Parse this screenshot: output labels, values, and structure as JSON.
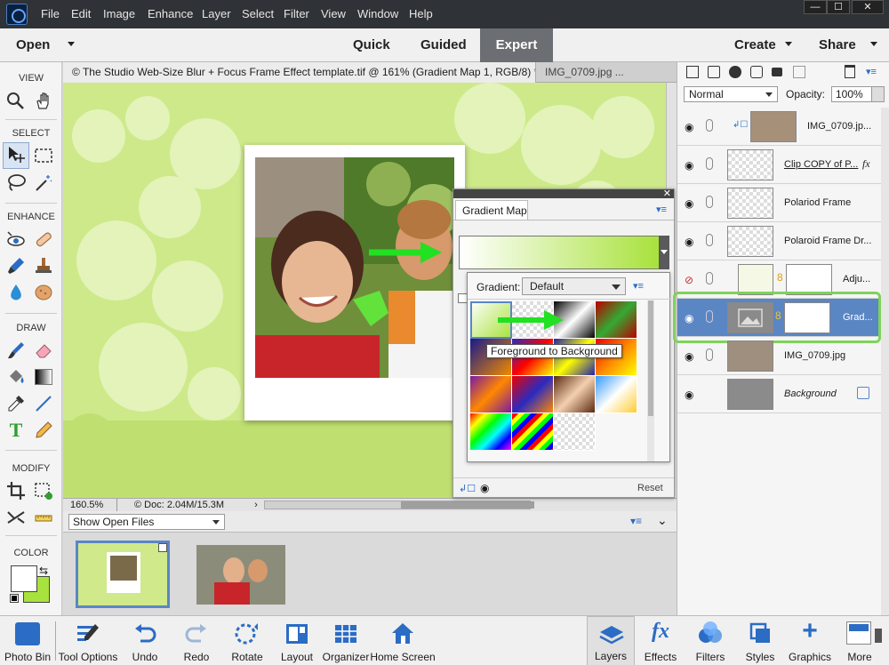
{
  "menubar": {
    "items": [
      "File",
      "Edit",
      "Image",
      "Enhance",
      "Layer",
      "Select",
      "Filter",
      "View",
      "Window",
      "Help"
    ],
    "window_buttons": [
      "—",
      "☐",
      "✕"
    ]
  },
  "modebar": {
    "open": "Open",
    "quick": "Quick",
    "guided": "Guided",
    "expert": "Expert",
    "create": "Create",
    "share": "Share"
  },
  "toolbox": {
    "view": "VIEW",
    "select": "SELECT",
    "enhance": "ENHANCE",
    "draw": "DRAW",
    "modify": "MODIFY",
    "color": "COLOR",
    "foreground_color": "#ffffff",
    "background_color": "#a8e23c"
  },
  "doctabs": {
    "active": "© The Studio Web-Size Blur + Focus Frame Effect template.tif @ 161% (Gradient Map 1, RGB/8) *",
    "inactive": "IMG_0709.jpg ..."
  },
  "status": {
    "zoom": "160.5%",
    "doc": "© Doc: 2.04M/15.3M"
  },
  "photobin": {
    "dropdown": "Show Open Files"
  },
  "gradient_map": {
    "tab": "Gradient Map",
    "gradient_label": "Gradient:",
    "gradient_value": "Default",
    "tooltip": "Foreground to Background",
    "reset": "Reset"
  },
  "layers": {
    "blend_mode": "Normal",
    "opacity_label": "Opacity:",
    "opacity_value": "100%",
    "rows": [
      {
        "name": "IMG_0709.jp..."
      },
      {
        "name": "Clip COPY of P..."
      },
      {
        "name": "Polariod Frame"
      },
      {
        "name": "Polaroid Frame Dr..."
      },
      {
        "name": "Adju..."
      },
      {
        "name": "Grad..."
      },
      {
        "name": "IMG_0709.jpg"
      },
      {
        "name": "Background"
      }
    ],
    "fx": "fx"
  },
  "bottombar": {
    "photo_bin": "Photo Bin",
    "tool_options": "Tool Options",
    "undo": "Undo",
    "redo": "Redo",
    "rotate": "Rotate",
    "layout": "Layout",
    "organizer": "Organizer",
    "home_screen": "Home Screen",
    "layers": "Layers",
    "effects": "Effects",
    "filters": "Filters",
    "styles": "Styles",
    "graphics": "Graphics",
    "more": "More"
  },
  "colors": {
    "accent": "#5a86c4",
    "canvas_tint": "#cfe98b",
    "highlight_outline": "#7ed35a",
    "arrow_green": "#22e022"
  }
}
